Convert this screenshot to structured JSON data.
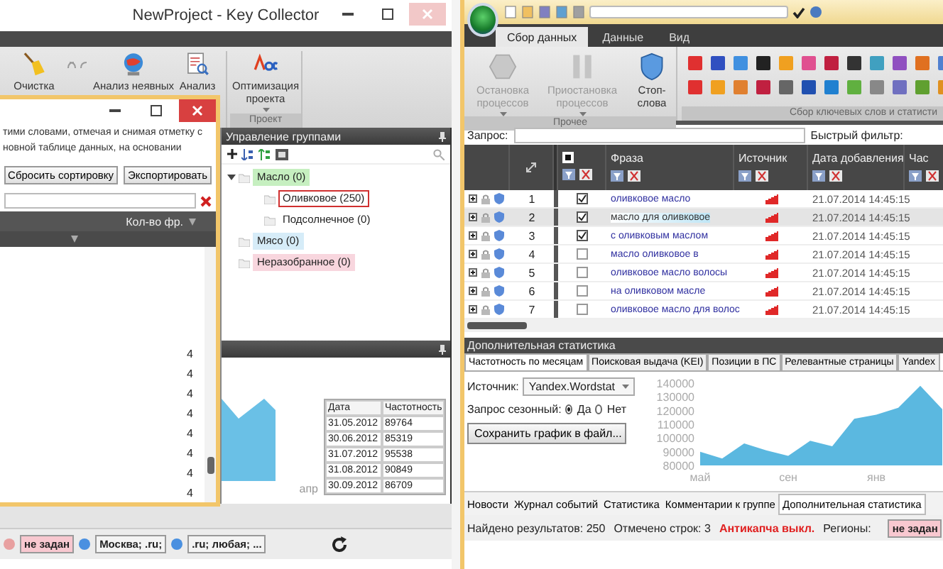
{
  "left_window": {
    "title": "NewProject - Key Collector",
    "ribbon": {
      "buttons": [
        {
          "label": "Очистка"
        },
        {
          "label": "Анализ неявных"
        },
        {
          "label": "Анализ"
        },
        {
          "label": "Оптимизация проекта"
        }
      ],
      "group_label": "Проект"
    },
    "dialog": {
      "text": "тими словами, отмечая и снимая отметку с новной таблице данных, на основании",
      "buttons": [
        "Сбросить сортировку",
        "Экспортировать"
      ],
      "column": "Кол-во фр.",
      "values": [
        "4",
        "4",
        "4",
        "4",
        "4",
        "4",
        "4",
        "4"
      ]
    },
    "groups_panel": {
      "title": "Управление группами",
      "tree": [
        {
          "label": "Масло (0)",
          "color": "#c6efc0",
          "selected": false,
          "children": [
            {
              "label": "Оливковое (250)",
              "selected": true
            },
            {
              "label": "Подсолнечное (0)",
              "selected": false
            }
          ]
        },
        {
          "label": "Мясо (0)",
          "color": "#d6ecf8",
          "selected": false
        },
        {
          "label": "Неразобранное (0)",
          "color": "#f8d6de",
          "selected": false
        }
      ]
    },
    "stats": {
      "axis_label": "апр",
      "columns": [
        "Дата",
        "Частотность"
      ],
      "rows": [
        [
          "31.05.2012",
          "89764"
        ],
        [
          "30.06.2012",
          "85319"
        ],
        [
          "31.07.2012",
          "95538"
        ],
        [
          "31.08.2012",
          "90849"
        ],
        [
          "30.09.2012",
          "86709"
        ]
      ]
    },
    "status_tags": [
      {
        "text": "не задан",
        "kind": "alert"
      },
      {
        "text": "Москва; .ru;",
        "kind": "region"
      },
      {
        "text": ".ru; любая; ...",
        "kind": "region"
      }
    ]
  },
  "right_window": {
    "tabs": [
      {
        "label": "Сбор данных",
        "selected": true
      },
      {
        "label": "Данные",
        "selected": false
      },
      {
        "label": "Вид",
        "selected": false
      }
    ],
    "ribbon": {
      "buttons": [
        {
          "label": "Остановка процессов",
          "disabled": true
        },
        {
          "label": "Приостановка процессов",
          "disabled": true
        },
        {
          "label": "Стоп-слова",
          "disabled": false
        }
      ],
      "groups": [
        "Прочее",
        "Сбор ключевых слов и статисти"
      ]
    },
    "query": {
      "label": "Запрос:",
      "filter_label": "Быстрый фильтр:"
    },
    "table": {
      "columns": [
        "Фраза",
        "Источник",
        "Дата добавления",
        "Час"
      ],
      "rows": [
        {
          "number": "1",
          "checked": true,
          "selected": false,
          "phrase": "оливковое масло",
          "date": "21.07.2014 14:45:15"
        },
        {
          "number": "2",
          "checked": true,
          "selected": true,
          "phrase": "масло для оливковое",
          "date": "21.07.2014 14:45:15"
        },
        {
          "number": "3",
          "checked": true,
          "selected": false,
          "phrase": "с оливковым маслом",
          "date": "21.07.2014 14:45:15"
        },
        {
          "number": "4",
          "checked": false,
          "selected": false,
          "phrase": "масло оливковое в",
          "date": "21.07.2014 14:45:15"
        },
        {
          "number": "5",
          "checked": false,
          "selected": false,
          "phrase": "оливковое масло волосы",
          "date": "21.07.2014 14:45:15"
        },
        {
          "number": "6",
          "checked": false,
          "selected": false,
          "phrase": "на оливковом масле",
          "date": "21.07.2014 14:45:15"
        },
        {
          "number": "7",
          "checked": false,
          "selected": false,
          "phrase": "оливковое масло для волос",
          "date": "21.07.2014 14:45:15"
        }
      ]
    },
    "stats_panel": {
      "title": "Дополнительная статистика",
      "tabs": [
        {
          "label": "Частотность по месяцам",
          "selected": true
        },
        {
          "label": "Поисковая выдача (KEI)",
          "selected": false
        },
        {
          "label": "Позиции в ПС",
          "selected": false
        },
        {
          "label": "Релевантные страницы",
          "selected": false
        },
        {
          "label": "Yandex",
          "selected": false
        }
      ],
      "source_label": "Источник:",
      "source": "Yandex.Wordstat",
      "seasonal_label": "Запрос сезонный:",
      "options": [
        {
          "label": "Да",
          "selected": true
        },
        {
          "label": "Нет",
          "selected": false
        }
      ],
      "save_button": "Сохранить график в файл...",
      "chart_data": {
        "type": "area",
        "categories": [
          "май",
          null,
          null,
          null,
          "сен",
          null,
          null,
          null,
          "янв",
          null,
          null,
          null
        ],
        "series": [
          {
            "color": "#5bb8e0",
            "values": [
              90000,
              85000,
              96000,
              91000,
              87000,
              98000,
              94000,
              114000,
              117000,
              122000,
              138000,
              121000
            ]
          }
        ],
        "ylim": [
          80000,
          140000
        ],
        "yticks": [
          80000,
          90000,
          100000,
          110000,
          120000,
          130000,
          140000
        ]
      }
    },
    "bottom_tabs": [
      {
        "label": "Новости",
        "selected": false
      },
      {
        "label": "Журнал событий",
        "selected": false
      },
      {
        "label": "Статистика",
        "selected": false
      },
      {
        "label": "Комментарии к группе",
        "selected": false
      },
      {
        "label": "Дополнительная статистика",
        "selected": true
      }
    ],
    "status_bar": {
      "found_label": "Найдено результатов:",
      "found": "250",
      "marked_label": "Отмечено строк:",
      "marked": "3",
      "anticaptcha": "Антикапча выкл.",
      "regions_label": "Регионы:",
      "region": "не задан"
    }
  }
}
